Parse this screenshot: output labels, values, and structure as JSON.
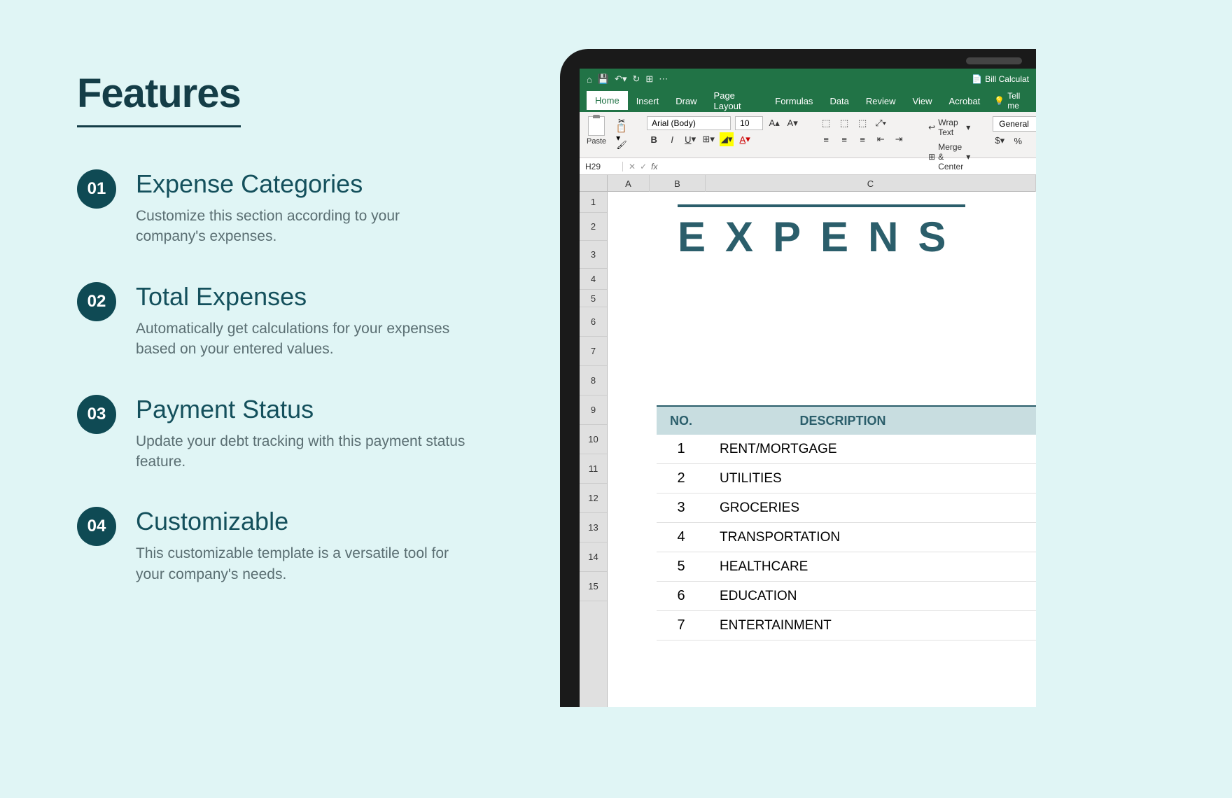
{
  "page_title": "Features",
  "features": [
    {
      "num": "01",
      "title": "Expense Categories",
      "desc": "Customize this section according to your company's expenses."
    },
    {
      "num": "02",
      "title": "Total Expenses",
      "desc": "Automatically get calculations for your expenses based on your entered values."
    },
    {
      "num": "03",
      "title": "Payment Status",
      "desc": "Update your debt tracking with this payment status feature."
    },
    {
      "num": "04",
      "title": "Customizable",
      "desc": "This customizable template is a versatile tool for your company's needs."
    }
  ],
  "excel": {
    "filename": "Bill Calculat",
    "tabs": [
      "Home",
      "Insert",
      "Draw",
      "Page Layout",
      "Formulas",
      "Data",
      "Review",
      "View",
      "Acrobat"
    ],
    "tell_me": "Tell me",
    "font_name": "Arial (Body)",
    "font_size": "10",
    "paste_label": "Paste",
    "wrap_text": "Wrap Text",
    "merge_center": "Merge & Center",
    "number_format": "General",
    "name_box": "H29",
    "col_headers": [
      "A",
      "B",
      "C"
    ],
    "row_headers": [
      "1",
      "2",
      "3",
      "4",
      "5",
      "6",
      "7",
      "8",
      "9",
      "10",
      "11",
      "12",
      "13",
      "14",
      "15"
    ],
    "sheet_title": "EXPENS",
    "table": {
      "headers": {
        "no": "NO.",
        "desc": "DESCRIPTION"
      },
      "rows": [
        {
          "no": "1",
          "desc": "RENT/MORTGAGE"
        },
        {
          "no": "2",
          "desc": "UTILITIES"
        },
        {
          "no": "3",
          "desc": "GROCERIES"
        },
        {
          "no": "4",
          "desc": "TRANSPORTATION"
        },
        {
          "no": "5",
          "desc": "HEALTHCARE"
        },
        {
          "no": "6",
          "desc": "EDUCATION"
        },
        {
          "no": "7",
          "desc": "ENTERTAINMENT"
        }
      ]
    }
  }
}
